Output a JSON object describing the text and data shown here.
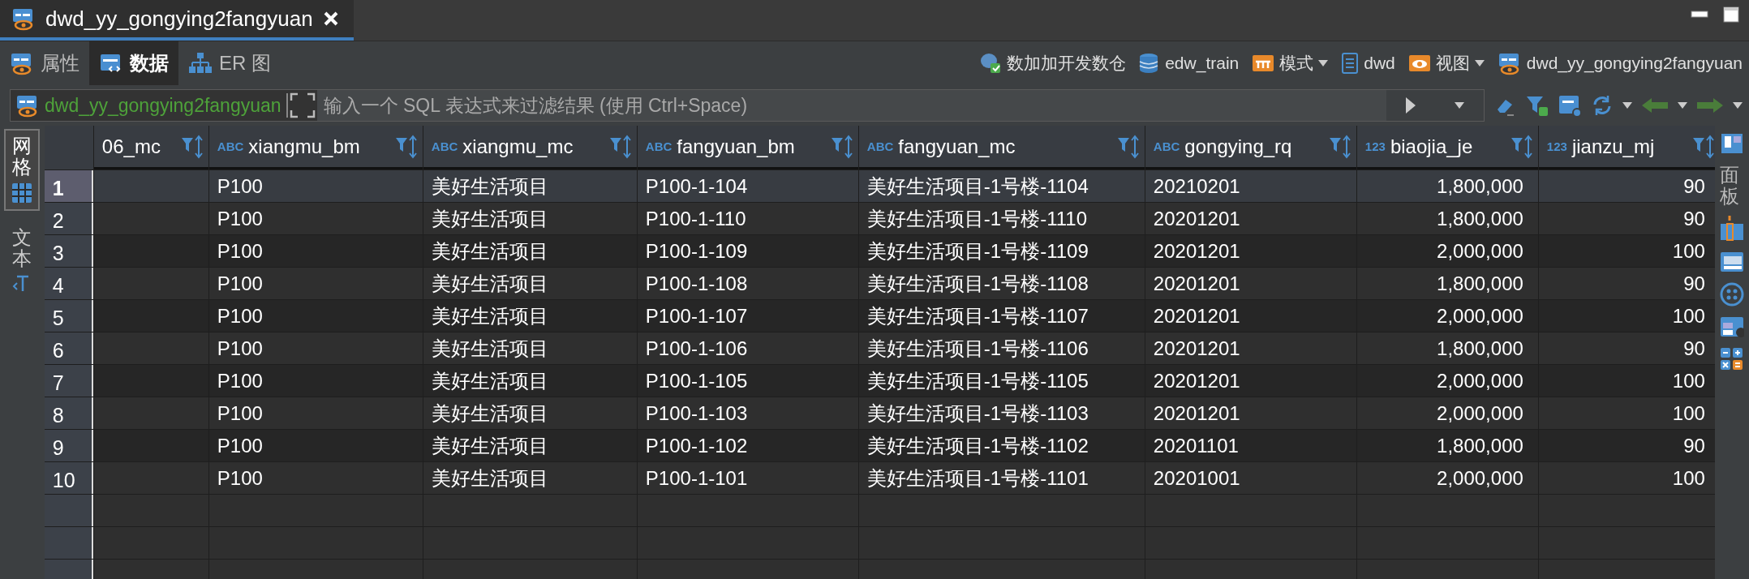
{
  "editor_tab": {
    "title": "dwd_yy_gongying2fangyuan"
  },
  "subtabs": [
    {
      "label": "属性",
      "selected": false
    },
    {
      "label": "数据",
      "selected": true
    },
    {
      "label": "ER 图",
      "selected": false
    }
  ],
  "breadcrumbs": [
    {
      "label": "数加加开发数仓",
      "dropdown": false
    },
    {
      "label": "edw_train",
      "dropdown": false
    },
    {
      "label": "模式",
      "dropdown": true
    },
    {
      "label": "dwd",
      "dropdown": false
    },
    {
      "label": "视图",
      "dropdown": true
    },
    {
      "label": "dwd_yy_gongying2fangyuan",
      "dropdown": false
    }
  ],
  "filter": {
    "table_name": "dwd_yy_gongying2fangyuan",
    "placeholder": "输入一个 SQL 表达式来过滤结果 (使用 Ctrl+Space)"
  },
  "side_tabs": [
    {
      "label": "网格",
      "selected": true
    },
    {
      "label": "文本",
      "selected": false
    }
  ],
  "right_panel": {
    "label": "面板"
  },
  "columns": [
    {
      "name": "06_mc",
      "kind": "text"
    },
    {
      "name": "xiangmu_bm",
      "kind": "text",
      "type_label": "ABC"
    },
    {
      "name": "xiangmu_mc",
      "kind": "text",
      "type_label": "ABC"
    },
    {
      "name": "fangyuan_bm",
      "kind": "text",
      "type_label": "ABC"
    },
    {
      "name": "fangyuan_mc",
      "kind": "text",
      "type_label": "ABC"
    },
    {
      "name": "gongying_rq",
      "kind": "text",
      "type_label": "ABC"
    },
    {
      "name": "biaojia_je",
      "kind": "number",
      "type_label": "123"
    },
    {
      "name": "jianzu_mj",
      "kind": "number",
      "type_label": "123"
    }
  ],
  "rows": [
    {
      "number": "1",
      "selected": true,
      "cells": [
        "",
        "P100",
        "美好生活项目",
        "P100-1-104",
        "美好生活项目-1号楼-1104",
        "20210201",
        "1,800,000",
        "90"
      ]
    },
    {
      "number": "2",
      "selected": false,
      "cells": [
        "",
        "P100",
        "美好生活项目",
        "P100-1-110",
        "美好生活项目-1号楼-1110",
        "20201201",
        "1,800,000",
        "90"
      ]
    },
    {
      "number": "3",
      "selected": false,
      "cells": [
        "",
        "P100",
        "美好生活项目",
        "P100-1-109",
        "美好生活项目-1号楼-1109",
        "20201201",
        "2,000,000",
        "100"
      ]
    },
    {
      "number": "4",
      "selected": false,
      "cells": [
        "",
        "P100",
        "美好生活项目",
        "P100-1-108",
        "美好生活项目-1号楼-1108",
        "20201201",
        "1,800,000",
        "90"
      ]
    },
    {
      "number": "5",
      "selected": false,
      "cells": [
        "",
        "P100",
        "美好生活项目",
        "P100-1-107",
        "美好生活项目-1号楼-1107",
        "20201201",
        "2,000,000",
        "100"
      ]
    },
    {
      "number": "6",
      "selected": false,
      "cells": [
        "",
        "P100",
        "美好生活项目",
        "P100-1-106",
        "美好生活项目-1号楼-1106",
        "20201201",
        "1,800,000",
        "90"
      ]
    },
    {
      "number": "7",
      "selected": false,
      "cells": [
        "",
        "P100",
        "美好生活项目",
        "P100-1-105",
        "美好生活项目-1号楼-1105",
        "20201201",
        "2,000,000",
        "100"
      ]
    },
    {
      "number": "8",
      "selected": false,
      "cells": [
        "",
        "P100",
        "美好生活项目",
        "P100-1-103",
        "美好生活项目-1号楼-1103",
        "20201201",
        "2,000,000",
        "100"
      ]
    },
    {
      "number": "9",
      "selected": false,
      "cells": [
        "",
        "P100",
        "美好生活项目",
        "P100-1-102",
        "美好生活项目-1号楼-1102",
        "20201101",
        "1,800,000",
        "90"
      ]
    },
    {
      "number": "10",
      "selected": false,
      "cells": [
        "",
        "P100",
        "美好生活项目",
        "P100-1-101",
        "美好生活项目-1号楼-1101",
        "20201001",
        "2,000,000",
        "100"
      ]
    }
  ]
}
